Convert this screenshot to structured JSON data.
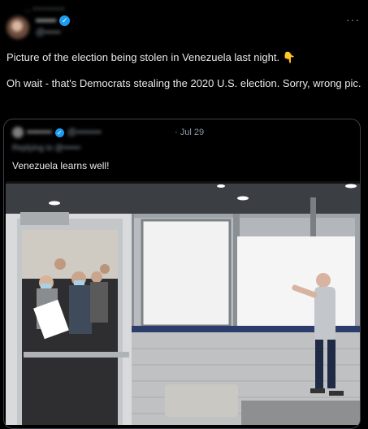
{
  "header": {
    "top_context": "… • • • • • • •",
    "name": "••••••",
    "verified_glyph": "✓",
    "handle": "@•••••",
    "more_glyph": "···"
  },
  "tweet": {
    "line1": "Picture of the election being stolen in Venezuela last night. 👇",
    "line2": "Oh wait - that's Democrats stealing the 2020 U.S. election.  Sorry, wrong pic."
  },
  "quote": {
    "name": "••••••••",
    "verified_glyph": "✓",
    "handle": "@••••••••",
    "date": "· Jul 29",
    "replying": "Replying to @••••••",
    "text": "Venezuela learns well!"
  },
  "colors": {
    "accent": "#1d9bf0",
    "background": "#000000",
    "text_primary": "#e7e9ea",
    "text_secondary": "#8b98a5"
  }
}
